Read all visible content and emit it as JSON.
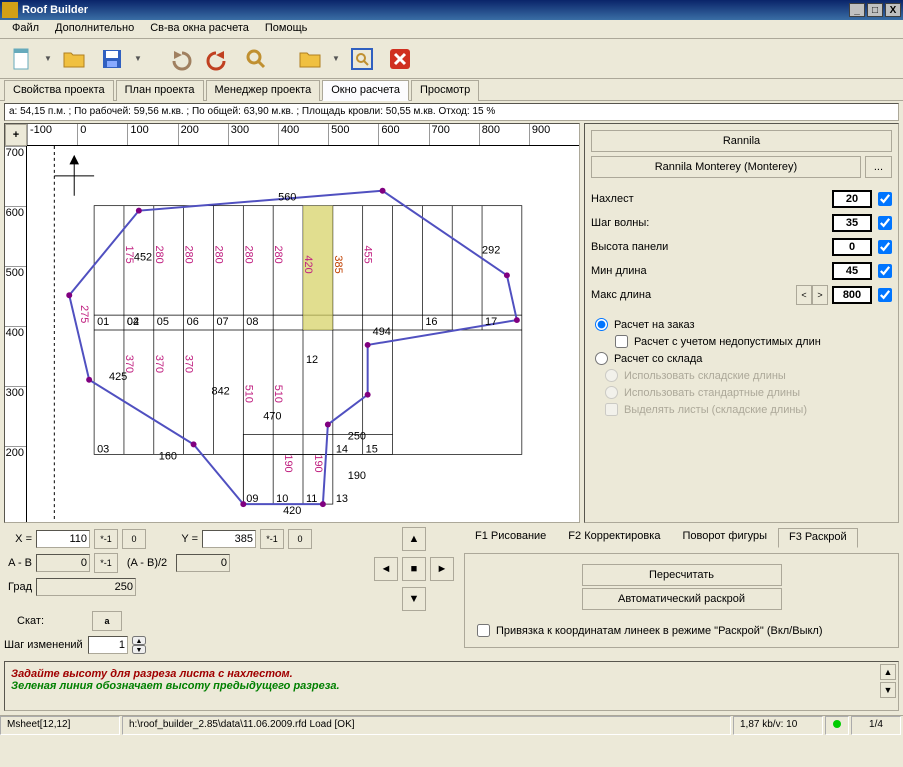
{
  "title": "Roof Builder",
  "menu": [
    "Файл",
    "Дополнительно",
    "Св-ва окна расчета",
    "Помощь"
  ],
  "tabs": [
    {
      "label": "Свойства проекта",
      "active": false
    },
    {
      "label": "План проекта",
      "active": false
    },
    {
      "label": "Менеджер проекта",
      "active": false
    },
    {
      "label": "Окно расчета",
      "active": true
    },
    {
      "label": "Просмотр",
      "active": false
    }
  ],
  "status_line": "a:  54,15 п.м. ; По рабочей:  59,56 м.кв. ; По общей:  63,90 м.кв. ; Площадь кровли:  50,55  м.кв. Отход: 15 %",
  "ruler_h": [
    "-100",
    "0",
    "100",
    "200",
    "300",
    "400",
    "500",
    "600",
    "700",
    "800",
    "900"
  ],
  "ruler_v": [
    "700",
    "600",
    "500",
    "400",
    "300",
    "200"
  ],
  "right": {
    "brand_btn": "Rannila",
    "model_btn": "Rannila Monterey (Monterey)",
    "more_btn": "...",
    "params": [
      {
        "label": "Нахлест",
        "value": "20",
        "checked": true
      },
      {
        "label": "Шаг волны:",
        "value": "35",
        "checked": true
      },
      {
        "label": "Высота панели",
        "value": "0",
        "checked": true
      },
      {
        "label": "Мин длина",
        "value": "45",
        "checked": true
      },
      {
        "label": "Макс длина",
        "value": "800",
        "checked": true,
        "spinner": true
      }
    ],
    "radio1": "Расчет на заказ",
    "check1": "Расчет с учетом недопустимых длин",
    "radio2": "Расчет со склада",
    "radio3": "Использовать складские длины",
    "radio4": "Использовать стандартные длины",
    "check2": "Выделять листы (складские длины)"
  },
  "coords": {
    "x_label": "X =",
    "x_val": "110",
    "x_btn1": "*-1",
    "x_btn2": "0",
    "y_label": "Y =",
    "y_val": "385",
    "y_btn1": "*-1",
    "y_btn2": "0",
    "ab_label": "A - B",
    "ab_val": "0",
    "ab_btn": "*-1",
    "ab2_label": "(A - B)/2",
    "ab2_val": "0",
    "grad_label": "Град",
    "grad_val": "250",
    "skat_label": "Скат:",
    "skat_btn": "a",
    "step_label": "Шаг изменений",
    "step_val": "1"
  },
  "rb_tabs": [
    {
      "label": "F1 Рисование"
    },
    {
      "label": "F2 Корректировка"
    },
    {
      "label": "Поворот фигуры"
    },
    {
      "label": "F3 Раскрой",
      "active": true
    }
  ],
  "rb": {
    "recalc": "Пересчитать",
    "auto": "Автоматический раскрой",
    "snap": "Привязка к координатам линеек в режиме \"Раскрой\" (Вкл/Выкл)"
  },
  "hints": [
    "Задайте высоту для разреза листа с нахлестом.",
    "Зеленая линия обозначает высоту предыдущего разреза."
  ],
  "statusbar": {
    "cell1": "Msheet[12,12]",
    "cell2": "h:\\roof_builder_2.85\\data\\11.06.2009.rfd Load [OK]",
    "cell3": "1,87 kb/v: 10",
    "cell4": "1/4"
  },
  "drawing": {
    "annotations": [
      "560",
      "452",
      "425",
      "292",
      "250",
      "494",
      "470",
      "420",
      "190",
      "160",
      "842"
    ],
    "panel_labels": [
      "275",
      "175",
      "280",
      "280",
      "280",
      "280",
      "280",
      "420",
      "385",
      "455",
      "370",
      "370",
      "370",
      "510",
      "510",
      "190",
      "190"
    ],
    "col_numbers": [
      "01",
      "02",
      "03",
      "04",
      "05",
      "06",
      "07",
      "08",
      "09",
      "10",
      "11",
      "12",
      "13",
      "14",
      "15",
      "16",
      "17"
    ]
  }
}
